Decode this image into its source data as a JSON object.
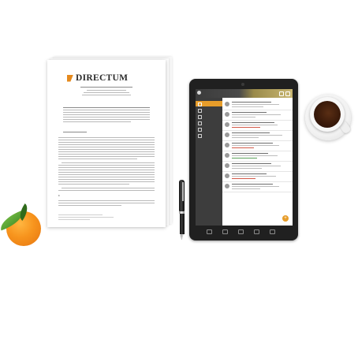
{
  "document": {
    "brand": "DIRECTUM",
    "section_number": "1"
  },
  "tablet": {
    "nav_items": [
      "",
      "",
      "",
      "",
      "",
      ""
    ],
    "fab_label": "+"
  },
  "colors": {
    "brand_orange": "#e58a1e",
    "app_accent": "#e79d2a",
    "tablet_body": "#202020",
    "orange_fruit": "#f7941d",
    "leaf_green": "#3e8a23",
    "coffee": "#3a1a0a"
  },
  "objects": [
    "paper-document",
    "tablet",
    "pen",
    "coffee-cup",
    "orange"
  ]
}
